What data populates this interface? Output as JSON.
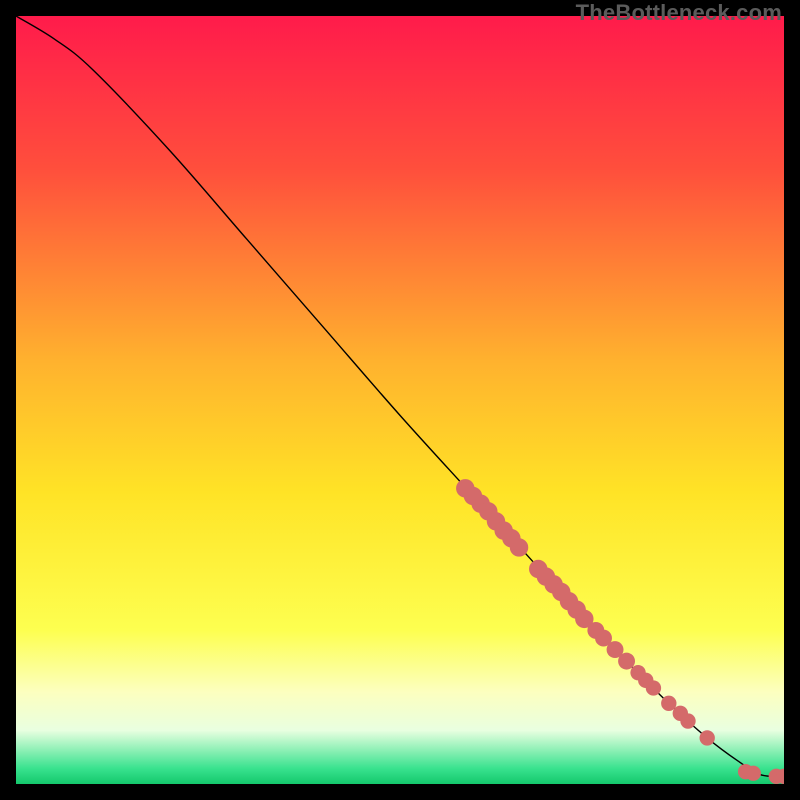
{
  "watermark": "TheBottleneck.com",
  "chart_data": {
    "type": "line",
    "title": "",
    "xlabel": "",
    "ylabel": "",
    "xlim": [
      0,
      100
    ],
    "ylim": [
      0,
      100
    ],
    "background_gradient_stops": [
      {
        "pct": 0.0,
        "color": "#ff1b4b"
      },
      {
        "pct": 20.0,
        "color": "#ff4f3c"
      },
      {
        "pct": 45.0,
        "color": "#ffb22e"
      },
      {
        "pct": 62.0,
        "color": "#ffe326"
      },
      {
        "pct": 80.0,
        "color": "#fdff50"
      },
      {
        "pct": 88.0,
        "color": "#fcffbf"
      },
      {
        "pct": 93.0,
        "color": "#e9ffe0"
      },
      {
        "pct": 98.0,
        "color": "#38e28e"
      },
      {
        "pct": 100.0,
        "color": "#14c86c"
      }
    ],
    "series": [
      {
        "name": "curve",
        "x": [
          0,
          5,
          10,
          20,
          30,
          40,
          50,
          60,
          70,
          78,
          85,
          90,
          94,
          97,
          100
        ],
        "y": [
          100,
          97,
          93,
          82.5,
          71,
          59.5,
          48,
          37,
          26,
          17.5,
          10.5,
          6,
          3,
          1.2,
          1
        ]
      }
    ],
    "markers": [
      {
        "name": "dot-seg-a-1",
        "x": 58.5,
        "y": 38.5,
        "r": 1.2
      },
      {
        "name": "dot-seg-a-2",
        "x": 59.5,
        "y": 37.5,
        "r": 1.2
      },
      {
        "name": "dot-seg-a-3",
        "x": 60.5,
        "y": 36.5,
        "r": 1.2
      },
      {
        "name": "dot-seg-a-4",
        "x": 61.5,
        "y": 35.5,
        "r": 1.2
      },
      {
        "name": "dot-seg-a-5",
        "x": 62.5,
        "y": 34.2,
        "r": 1.2
      },
      {
        "name": "dot-seg-a-6",
        "x": 63.5,
        "y": 33.0,
        "r": 1.2
      },
      {
        "name": "dot-seg-a-7",
        "x": 64.5,
        "y": 32.0,
        "r": 1.2
      },
      {
        "name": "dot-seg-a-8",
        "x": 65.5,
        "y": 30.8,
        "r": 1.2
      },
      {
        "name": "dot-seg-b-1",
        "x": 68.0,
        "y": 28.0,
        "r": 1.2
      },
      {
        "name": "dot-seg-b-2",
        "x": 69.0,
        "y": 27.0,
        "r": 1.2
      },
      {
        "name": "dot-seg-b-3",
        "x": 70.0,
        "y": 26.0,
        "r": 1.2
      },
      {
        "name": "dot-seg-b-4",
        "x": 71.0,
        "y": 25.0,
        "r": 1.2
      },
      {
        "name": "dot-seg-b-5",
        "x": 72.0,
        "y": 23.8,
        "r": 1.2
      },
      {
        "name": "dot-seg-b-6",
        "x": 73.0,
        "y": 22.7,
        "r": 1.2
      },
      {
        "name": "dot-seg-b-7",
        "x": 74.0,
        "y": 21.5,
        "r": 1.2
      },
      {
        "name": "dot-seg-c-1",
        "x": 75.5,
        "y": 20.0,
        "r": 1.1
      },
      {
        "name": "dot-seg-c-2",
        "x": 76.5,
        "y": 19.0,
        "r": 1.1
      },
      {
        "name": "dot-seg-c-3",
        "x": 78.0,
        "y": 17.5,
        "r": 1.1
      },
      {
        "name": "dot-seg-c-4",
        "x": 79.5,
        "y": 16.0,
        "r": 1.1
      },
      {
        "name": "dot-seg-d-1",
        "x": 81.0,
        "y": 14.5,
        "r": 1.0
      },
      {
        "name": "dot-seg-d-2",
        "x": 82.0,
        "y": 13.5,
        "r": 1.0
      },
      {
        "name": "dot-seg-d-3",
        "x": 83.0,
        "y": 12.5,
        "r": 1.0
      },
      {
        "name": "dot-seg-e-1",
        "x": 85.0,
        "y": 10.5,
        "r": 1.0
      },
      {
        "name": "dot-seg-e-2",
        "x": 86.5,
        "y": 9.2,
        "r": 1.0
      },
      {
        "name": "dot-seg-e-3",
        "x": 87.5,
        "y": 8.2,
        "r": 1.0
      },
      {
        "name": "dot-seg-f-1",
        "x": 90.0,
        "y": 6.0,
        "r": 1.0
      },
      {
        "name": "dot-tail-1",
        "x": 95.0,
        "y": 1.6,
        "r": 1.0
      },
      {
        "name": "dot-tail-2",
        "x": 96.0,
        "y": 1.4,
        "r": 1.0
      },
      {
        "name": "dot-tail-3",
        "x": 99.0,
        "y": 1.0,
        "r": 1.0
      },
      {
        "name": "dot-tail-4",
        "x": 100.0,
        "y": 1.0,
        "r": 1.0
      }
    ],
    "marker_color": "#d46a6a",
    "line_color": "#000000"
  }
}
